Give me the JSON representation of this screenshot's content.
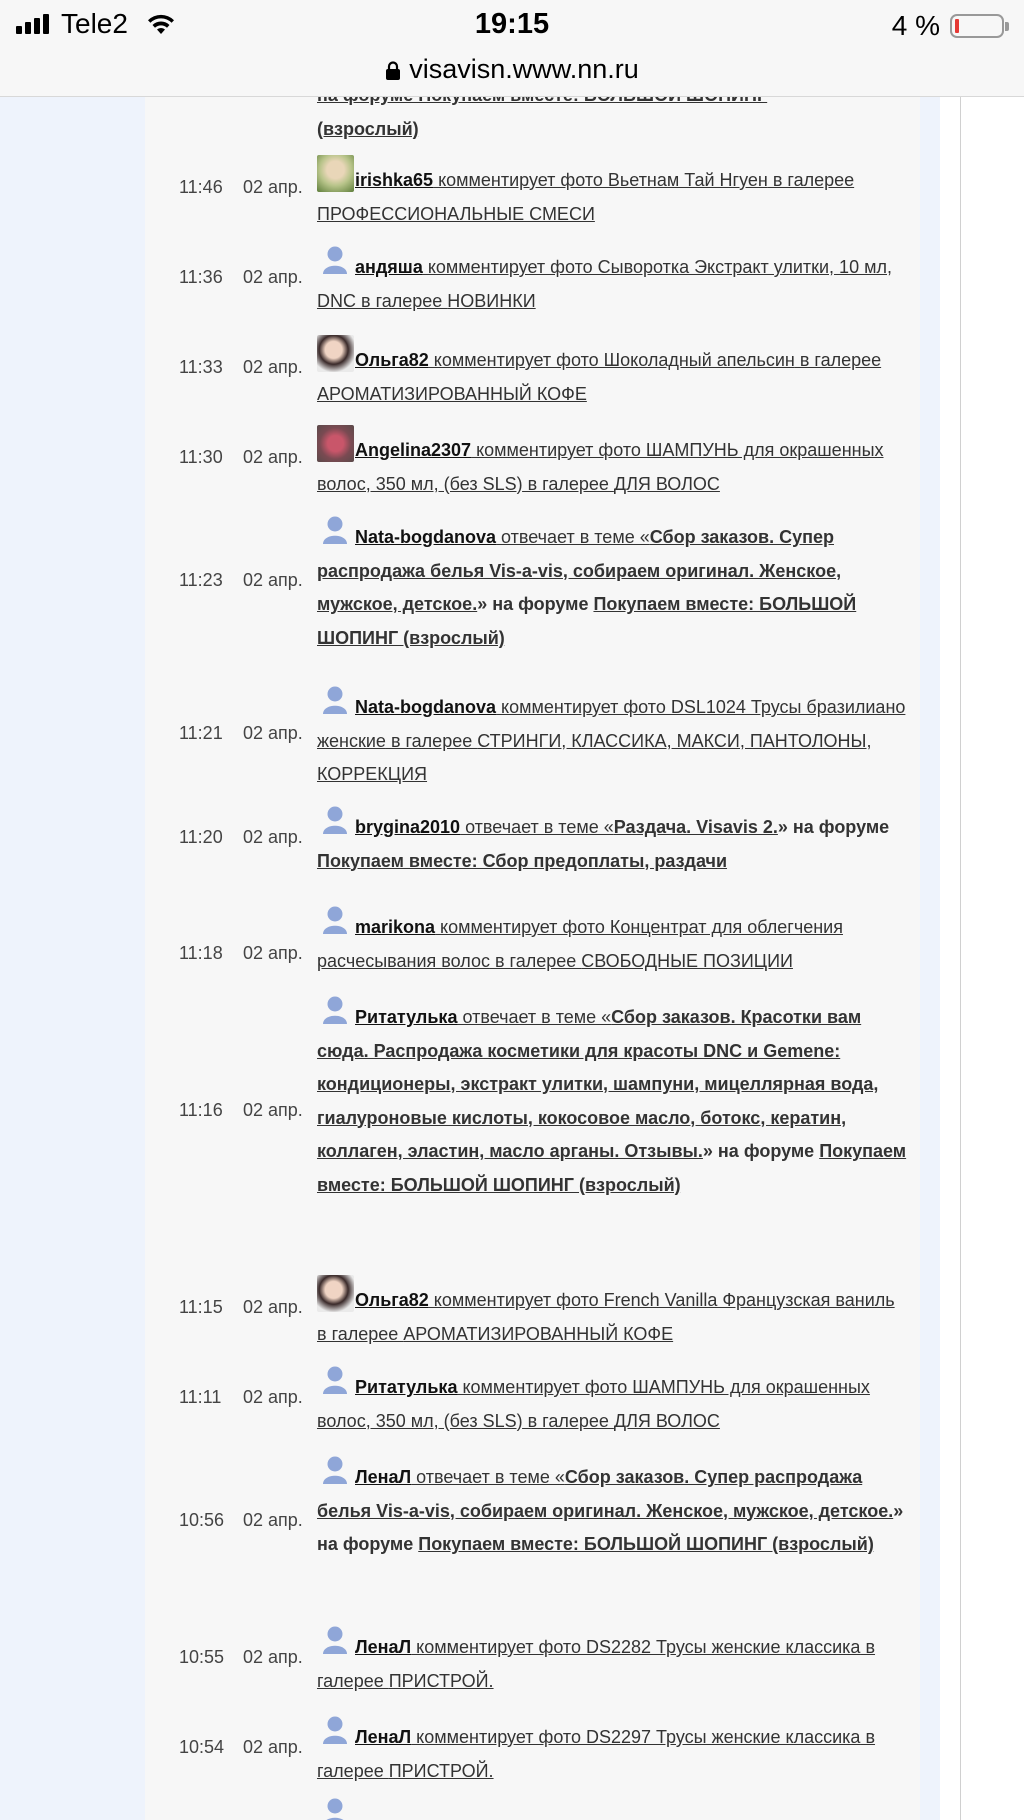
{
  "status_bar": {
    "carrier": "Tele2",
    "time": "19:15",
    "battery_text": "4 %",
    "battery_level": 0.04
  },
  "url_bar": {
    "url": "visavisn.www.nn.ru"
  },
  "colors": {
    "page_bg": "#f7f7f7",
    "side_bg": "#eef3fc",
    "battery_low": "#e53935"
  },
  "feed": {
    "top_partial": {
      "text1": "на форуме Покупаем вместе: БОЛЬШОЙ ШОПИНГ",
      "text2": "(взрослый)"
    },
    "items": [
      {
        "time": "11:46",
        "date": "02 апр.",
        "avatar": "photo",
        "user": "irishka65",
        "action": " комментирует фото Вьетнам Тай Нгуен",
        "mid": " в галерее ",
        "target": "ПРОФЕССИОНАЛЬНЫЕ СМЕСИ",
        "suffix": ""
      },
      {
        "time": "11:36",
        "date": "02 апр.",
        "avatar": "default",
        "user": "андяша",
        "action": " комментирует фото Сыворотка Экстракт улитки, 10 мл, DNC",
        "mid": " в галерее ",
        "target": "НОВИНКИ",
        "suffix": ""
      },
      {
        "time": "11:33",
        "date": "02 апр.",
        "avatar": "photo",
        "user": "Ольга82",
        "action": " комментирует фото Шоколадный апельсин",
        "mid": " в галерее ",
        "target": "АРОМАТИЗИРОВАННЫЙ КОФЕ",
        "suffix": ""
      },
      {
        "time": "11:30",
        "date": "02 апр.",
        "avatar": "photo",
        "user": "Angelina2307",
        "action": " комментирует фото ШАМПУНЬ для окрашенных волос, 350 мл, (без SLS)",
        "mid": " в галерее ",
        "target": "ДЛЯ ВОЛОС",
        "suffix": ""
      },
      {
        "time": "11:23",
        "date": "02 апр.",
        "avatar": "default",
        "user": "Nata-bogdanova",
        "action": " отвечает в теме «",
        "topic": "Сбор заказов. Супер распродажа белья Vis-a-vis, собираем оригинал. Женское, мужское, детское.",
        "mid": "» на форуме ",
        "target": "Покупаем вместе: БОЛЬШОЙ ШОПИНГ (взрослый)",
        "suffix": ""
      },
      {
        "time": "11:21",
        "date": "02 апр.",
        "avatar": "default",
        "user": "Nata-bogdanova",
        "action": " комментирует фото DSL1024 Трусы бразилиано женские",
        "mid": " в галерее ",
        "target": "СТРИНГИ, КЛАССИКА, МАКСИ, ПАНТОЛОНЫ, КОРРЕКЦИЯ",
        "suffix": ""
      },
      {
        "time": "11:20",
        "date": "02 апр.",
        "avatar": "default",
        "user": "brygina2010",
        "action": " отвечает в теме «",
        "topic": "Раздача. Visavis 2.",
        "mid": "» на форуме ",
        "target": "Покупаем вместе: Сбор предоплаты, раздачи",
        "suffix": ""
      },
      {
        "time": "11:18",
        "date": "02 апр.",
        "avatar": "default",
        "user": "marikona",
        "action": " комментирует фото Концентрат для облегчения расчесывания волос",
        "mid": " в галерее ",
        "target": "СВОБОДНЫЕ ПОЗИЦИИ",
        "suffix": ""
      },
      {
        "time": "11:16",
        "date": "02 апр.",
        "avatar": "default",
        "user": "Ритатулька",
        "action": " отвечает в теме «",
        "topic": "Сбор заказов. Красотки вам сюда. Распродажа косметики для красоты DNC и Gemene: кондиционеры, экстракт улитки, шампуни, мицеллярная вода, гиалуроновые кислоты, кокосовое масло, ботокс, кератин, коллаген, эластин, масло арганы. Отзывы.",
        "mid": "» на форуме ",
        "target": "Покупаем вместе: БОЛЬШОЙ ШОПИНГ (взрослый)",
        "suffix": ""
      },
      {
        "time": "11:15",
        "date": "02 апр.",
        "avatar": "photo",
        "user": "Ольга82",
        "action": " комментирует фото French Vanilla Французская ваниль",
        "mid": " в галерее ",
        "target": "АРОМАТИЗИРОВАННЫЙ КОФЕ",
        "suffix": ""
      },
      {
        "time": "11:11",
        "date": "02 апр.",
        "avatar": "default",
        "user": "Ритатулька",
        "action": " комментирует фото ШАМПУНЬ для окрашенных волос, 350 мл, (без SLS)",
        "mid": " в галерее ",
        "target": "ДЛЯ ВОЛОС",
        "suffix": ""
      },
      {
        "time": "10:56",
        "date": "02 апр.",
        "avatar": "default",
        "user": "ЛенаЛ",
        "action": " отвечает в теме «",
        "topic": "Сбор заказов. Супер распродажа белья Vis-a-vis, собираем оригинал. Женское, мужское, детское.",
        "mid": "» на форуме ",
        "target": "Покупаем вместе: БОЛЬШОЙ ШОПИНГ (взрослый)",
        "suffix": ""
      },
      {
        "time": "10:55",
        "date": "02 апр.",
        "avatar": "default",
        "user": "ЛенаЛ",
        "action": " комментирует фото DS2282 Трусы женские классика",
        "mid": " в галерее ",
        "target": "ПРИСТРОЙ.",
        "suffix": ""
      },
      {
        "time": "10:54",
        "date": "02 апр.",
        "avatar": "default",
        "user": "ЛенаЛ",
        "action": " комментирует фото DS2297 Трусы женские классика",
        "mid": " в галерее ",
        "target": "ПРИСТРОЙ.",
        "suffix": ""
      }
    ]
  }
}
